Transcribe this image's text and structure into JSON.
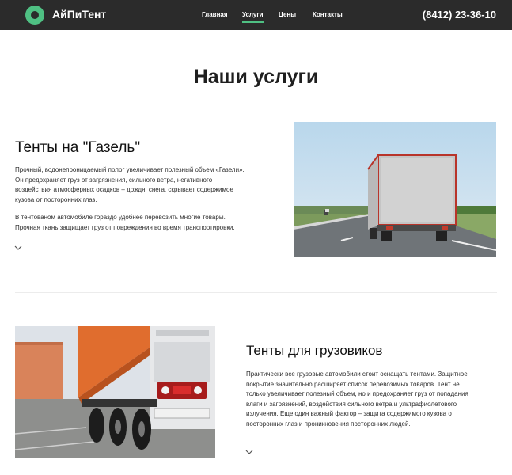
{
  "header": {
    "logo_text": "АйПиТент",
    "nav": [
      {
        "label": "Главная"
      },
      {
        "label": "Услуги"
      },
      {
        "label": "Цены"
      },
      {
        "label": "Контакты"
      }
    ],
    "phone": "(8412) 23-36-10"
  },
  "main": {
    "title": "Наши услуги",
    "services": [
      {
        "title": "Тенты на \"Газель\"",
        "paragraph_1_lines": [
          "Прочный, водонепроницаемый полог увеличивает полезный объем «Газели».",
          "Он предохраняет груз от загрязнения, сильного ветра, негативного",
          "воздействия атмосферных осадков – дождя, снега, скрывает содержимое",
          "кузова от посторонних глаз."
        ],
        "paragraph_2_lines": [
          "В тентованом автомобиле гораздо удобнее перевозить многие товары.",
          "Прочная ткань защищает груз от повреждения во время транспортировки,"
        ]
      },
      {
        "title": "Тенты для грузовиков",
        "paragraph_1_lines": [
          "Практически все грузовые автомобили стоит оснащать тентами. Защитное",
          "покрытие значительно расширяет список перевозимых товаров. Тент не",
          "только увеличивает полезный объем, но и предохраняет груз от попадания",
          "влаги и загрязнений, воздействия сильного ветра и ультрафиолетового",
          "излучения. Еще один важный фактор – защита содержимого кузова от",
          "посторонних глаз и проникновения посторонних людей."
        ]
      }
    ]
  },
  "colors": {
    "header_bg": "#2b2b2b",
    "accent": "#4fc083"
  },
  "icons": [
    "logo-ring-icon",
    "chevron-down-icon"
  ]
}
